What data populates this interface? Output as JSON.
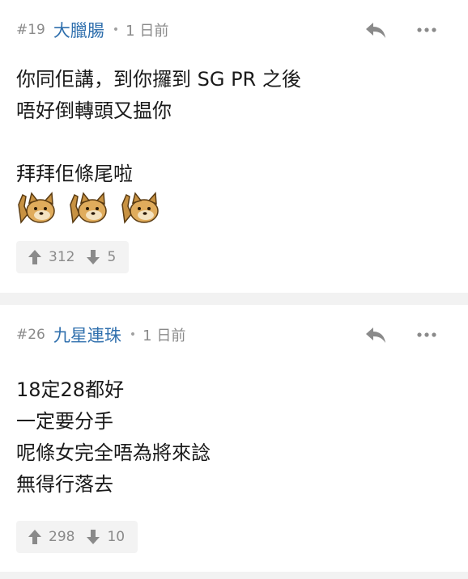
{
  "posts": [
    {
      "floor": "#19",
      "author": "大臘腸",
      "separator": "•",
      "time": "1 日前",
      "lines": [
        "你同佢講，到你攞到 SG PR 之後",
        "唔好倒轉頭又揾你",
        "",
        "拜拜佢條尾啦"
      ],
      "emoji_count": 3,
      "upvotes": "312",
      "downvotes": "5"
    },
    {
      "floor": "#26",
      "author": "九星連珠",
      "separator": "•",
      "time": "1 日前",
      "lines": [
        "18定28都好",
        "一定要分手",
        "呢條女完全唔為將來諗",
        "無得行落去"
      ],
      "upvotes": "298",
      "downvotes": "10"
    }
  ],
  "colors": {
    "author": "#2f6fad",
    "meta": "#8a8a8a",
    "vote_bg": "#f3f3f3",
    "page_bg": "#f2f2f2"
  },
  "icons": [
    "reply-icon",
    "more-icon",
    "upvote-icon",
    "downvote-icon",
    "doge-emoji-icon"
  ]
}
